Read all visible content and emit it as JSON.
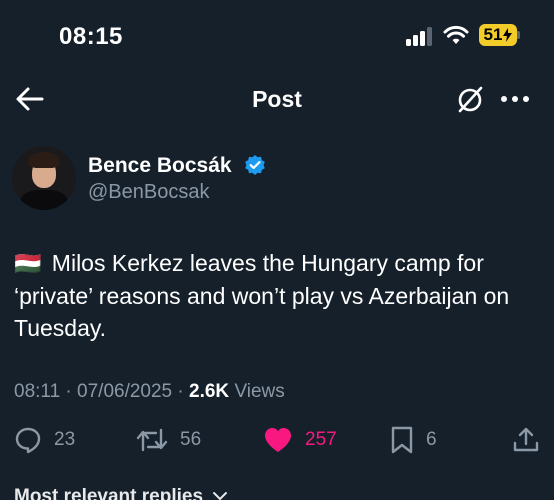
{
  "status_bar": {
    "time": "08:15",
    "battery": "51"
  },
  "nav": {
    "title": "Post"
  },
  "author": {
    "name": "Bence Bocsák",
    "handle": "@BenBocsak",
    "verified": true
  },
  "post": {
    "flag": "🇭🇺",
    "text": "Milos Kerkez leaves the Hungary camp for ‘private’ reasons and won’t play vs Azerbaijan on Tuesday.",
    "time": "08:11",
    "date": "07/06/2025",
    "views_count": "2.6K",
    "views_label": "Views"
  },
  "actions": {
    "replies": "23",
    "reposts": "56",
    "likes": "257",
    "bookmarks": "6"
  },
  "replies_header": "Most relevant replies",
  "colors": {
    "background": "#15202b",
    "secondary_text": "#8b98a5",
    "like_accent": "#f91880",
    "verified_blue": "#1d9bf0",
    "battery_yellow": "#f2cc28"
  }
}
